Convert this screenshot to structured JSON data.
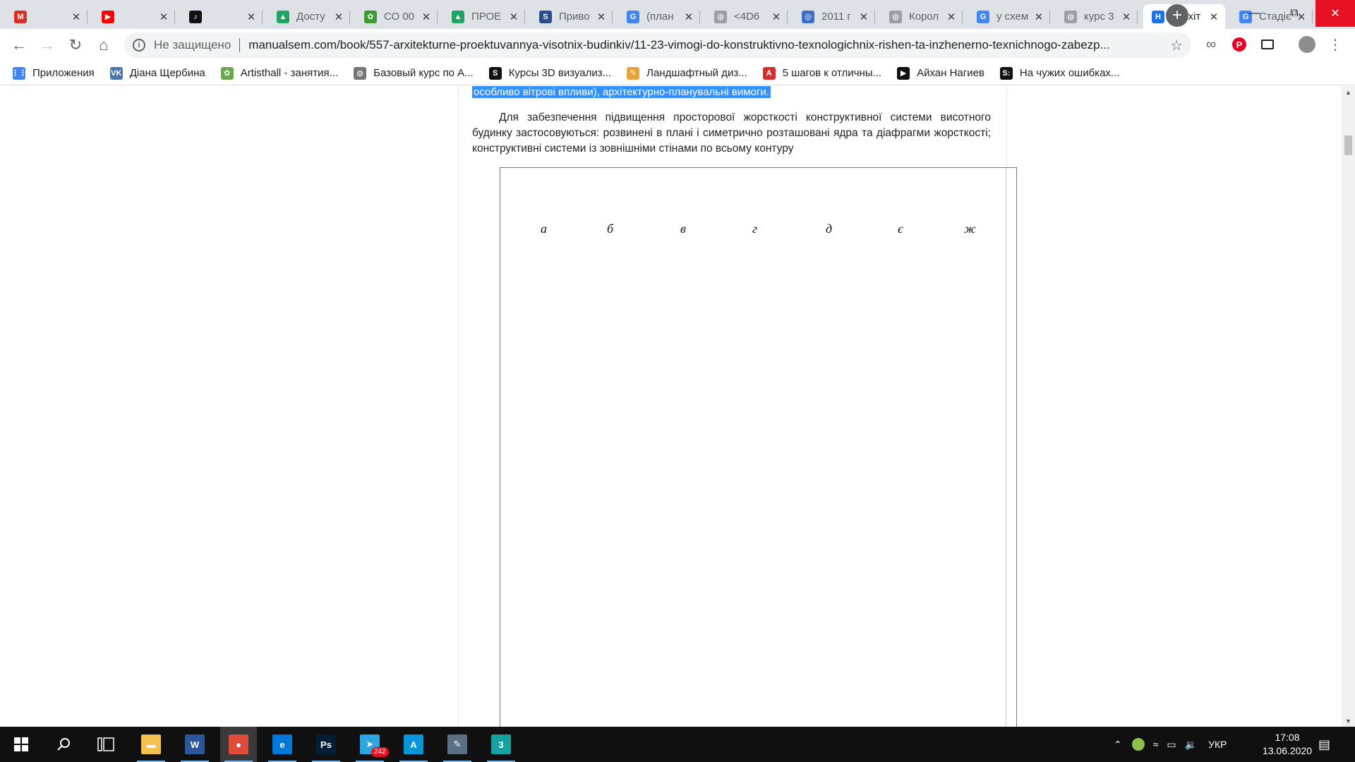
{
  "tabs": [
    {
      "title": "",
      "icon": "gmail-icon",
      "color": "#d93025",
      "glyph": "M"
    },
    {
      "title": "",
      "icon": "youtube-icon",
      "color": "#ff0000",
      "glyph": "▶"
    },
    {
      "title": "",
      "icon": "tiktok-icon",
      "color": "#111111",
      "glyph": "♪"
    },
    {
      "title": "Досту",
      "icon": "google-drive-icon",
      "color": "#1fa463",
      "glyph": "▲"
    },
    {
      "title": "СО 00",
      "icon": "site-icon",
      "color": "#3c9a2e",
      "glyph": "✿"
    },
    {
      "title": "ПРОЕ",
      "icon": "google-drive-icon",
      "color": "#1fa463",
      "glyph": "▲"
    },
    {
      "title": "Приво",
      "icon": "s-icon",
      "color": "#2a4d8f",
      "glyph": "S"
    },
    {
      "title": "(план",
      "icon": "google-icon",
      "color": "#4285f4",
      "glyph": "G"
    },
    {
      "title": "<4D6",
      "icon": "globe-icon",
      "color": "#9aa0a6",
      "glyph": "◍"
    },
    {
      "title": "2011 г",
      "icon": "site-icon",
      "color": "#3b6fc4",
      "glyph": "◎"
    },
    {
      "title": "Корол",
      "icon": "globe-icon",
      "color": "#9aa0a6",
      "glyph": "◍"
    },
    {
      "title": "у схем",
      "icon": "google-icon",
      "color": "#4285f4",
      "glyph": "G"
    },
    {
      "title": "курс 3",
      "icon": "globe-icon",
      "color": "#9aa0a6",
      "glyph": "◍"
    },
    {
      "title": "\"Архіт",
      "icon": "site-h-icon",
      "color": "#1a73e8",
      "glyph": "H",
      "active": true
    },
    {
      "title": "Стадіє",
      "icon": "google-icon",
      "color": "#4285f4",
      "glyph": "G"
    }
  ],
  "address": {
    "security": "Не защищено",
    "url": "manualsem.com/book/557-arxitekturne-proektuvannya-visotnix-budinkiv/11-23-vimogi-do-konstruktivno-texnologichnix-rishen-ta-inzhenerno-texnichnogo-zabezp..."
  },
  "bookmarks": [
    {
      "label": "Приложения",
      "icon": "apps-grid-icon",
      "color": "#4285f4",
      "glyph": "⋮⋮"
    },
    {
      "label": "Діана Щербина",
      "icon": "vk-icon",
      "color": "#4a76a8",
      "glyph": "VK"
    },
    {
      "label": "Artisthall - занятия...",
      "icon": "leaf-icon",
      "color": "#6aa84f",
      "glyph": "✿"
    },
    {
      "label": "Базовый курс по А...",
      "icon": "globe-icon",
      "color": "#757575",
      "glyph": "◍"
    },
    {
      "label": "Курсы 3D визуализ...",
      "icon": "s-logo-icon",
      "color": "#111111",
      "glyph": "S"
    },
    {
      "label": "Ландшафтный диз...",
      "icon": "pen-icon",
      "color": "#e8a33d",
      "glyph": "✎"
    },
    {
      "label": "5 шагов к отличны...",
      "icon": "a-red-icon",
      "color": "#d32f2f",
      "glyph": "A"
    },
    {
      "label": "Айхан Нагиев",
      "icon": "youtube-icon",
      "color": "#111111",
      "glyph": "▶"
    },
    {
      "label": "На чужих ошибках...",
      "icon": "s-colon-icon",
      "color": "#111111",
      "glyph": "S:"
    }
  ],
  "page": {
    "highlight_text": "особливо вітрові впливи), архітектурно-планувальні вимоги.",
    "paragraph": "Для забезпечення підвищення просторової жорсткості конструктивної системи висотного будинку застосовуються: розвинені в плані і симетрично розташовані ядра та діафрагми жорсткості; конструктивні системи із зовнішніми стінами по всьому контуру",
    "figure_labels": [
      "а",
      "б",
      "в",
      "г",
      "д",
      "є",
      "ж"
    ]
  },
  "taskbar": {
    "apps": [
      {
        "name": "file-explorer",
        "glyph": "▬",
        "color": "#f2c14e"
      },
      {
        "name": "word",
        "glyph": "W",
        "color": "#2b579a"
      },
      {
        "name": "chrome",
        "glyph": "●",
        "color": "#dd4b39",
        "active": true
      },
      {
        "name": "edge",
        "glyph": "e",
        "color": "#0078d7"
      },
      {
        "name": "photoshop",
        "glyph": "Ps",
        "color": "#001e36"
      },
      {
        "name": "telegram",
        "glyph": "➤",
        "color": "#2ca5e0",
        "badge": "242"
      },
      {
        "name": "autodesk",
        "glyph": "A",
        "color": "#0696d7"
      },
      {
        "name": "sketch-tool",
        "glyph": "✎",
        "color": "#5b7083"
      },
      {
        "name": "3ds-max",
        "glyph": "3",
        "color": "#17a2a2"
      }
    ],
    "language": "УКР",
    "time": "17:08",
    "date": "13.06.2020"
  }
}
